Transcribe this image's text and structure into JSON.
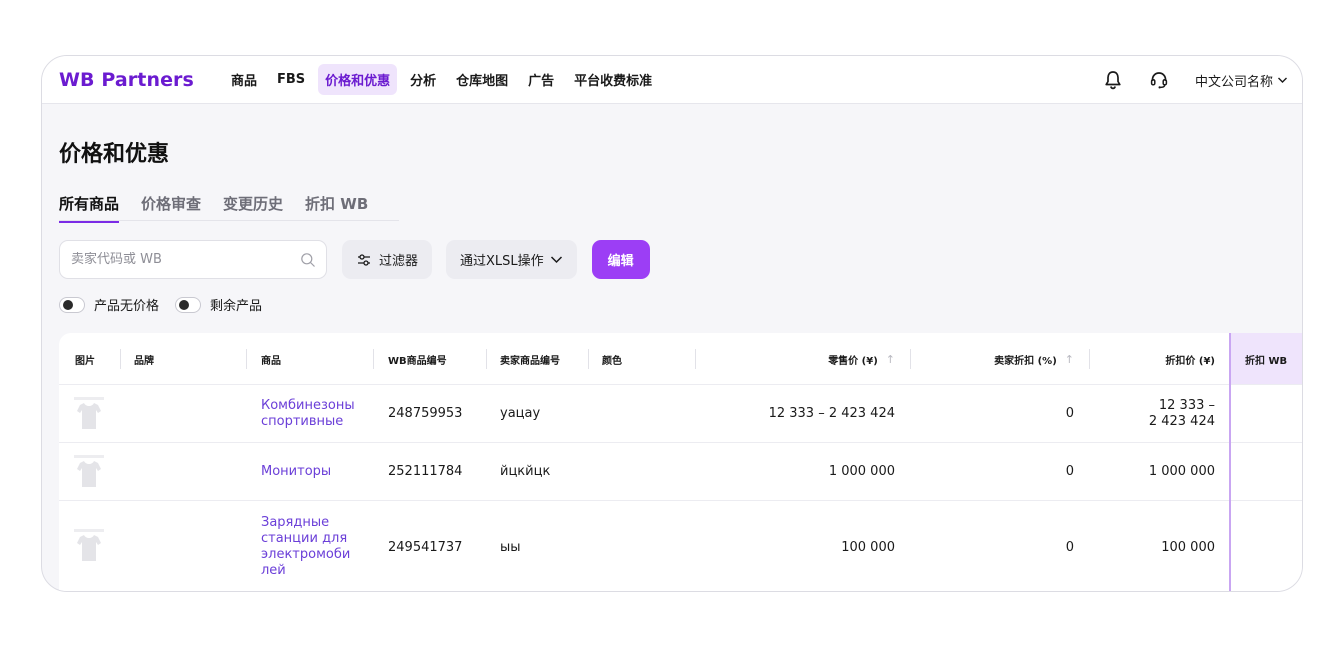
{
  "app": {
    "logo": "WB Partners",
    "nav": [
      "商品",
      "FBS",
      "价格和优惠",
      "分析",
      "仓库地图",
      "广告",
      "平台收费标准"
    ],
    "active_nav": "价格和优惠",
    "company": "中文公司名称"
  },
  "page": {
    "title": "价格和优惠",
    "tabs": [
      "所有商品",
      "价格审查",
      "变更历史",
      "折扣 WB"
    ],
    "active_tab": "所有商品"
  },
  "toolbar": {
    "search_placeholder": "卖家代码或 WB",
    "filter_label": "过滤器",
    "xlsl_label": "通过XLSL操作",
    "edit_label": "编辑"
  },
  "toggles": [
    "产品无价格",
    "剩余产品"
  ],
  "table": {
    "columns": [
      "图片",
      "品牌",
      "商品",
      "WB商品编号",
      "卖家商品编号",
      "颜色",
      "零售价 (¥)",
      "卖家折扣 (%)",
      "折扣价 (¥)",
      "折扣 WB"
    ],
    "rows": [
      {
        "brand": "",
        "product": "Комбинезоны спортивные",
        "wb_id": "248759953",
        "seller_code": "уацау",
        "color": "",
        "retail_price": "12 333 – 2 423 424",
        "seller_discount": "0",
        "discount_price_line1": "12 333 –",
        "discount_price_line2": "2 423 424"
      },
      {
        "brand": "",
        "product": "Мониторы",
        "wb_id": "252111784",
        "seller_code": "йцкйцк",
        "color": "",
        "retail_price": "1 000 000",
        "seller_discount": "0",
        "discount_price_line1": "1 000 000",
        "discount_price_line2": ""
      },
      {
        "brand": "",
        "product": "Зарядные станции для электромоби лей",
        "wb_id": "249541737",
        "seller_code": "ыы",
        "color": "",
        "retail_price": "100 000",
        "seller_discount": "0",
        "discount_price_line1": "100 000",
        "discount_price_line2": ""
      }
    ]
  },
  "icons": [
    "bell-icon",
    "headset-icon",
    "chevron-down-icon",
    "search-icon",
    "filter-icon",
    "sort-arrow-icon",
    "product-thumbnail"
  ],
  "colors": {
    "brand": "#6b1bd0",
    "primary_button": "#9c3ef5",
    "link": "#6b3fd8",
    "active_nav_bg": "#efe4fc"
  }
}
